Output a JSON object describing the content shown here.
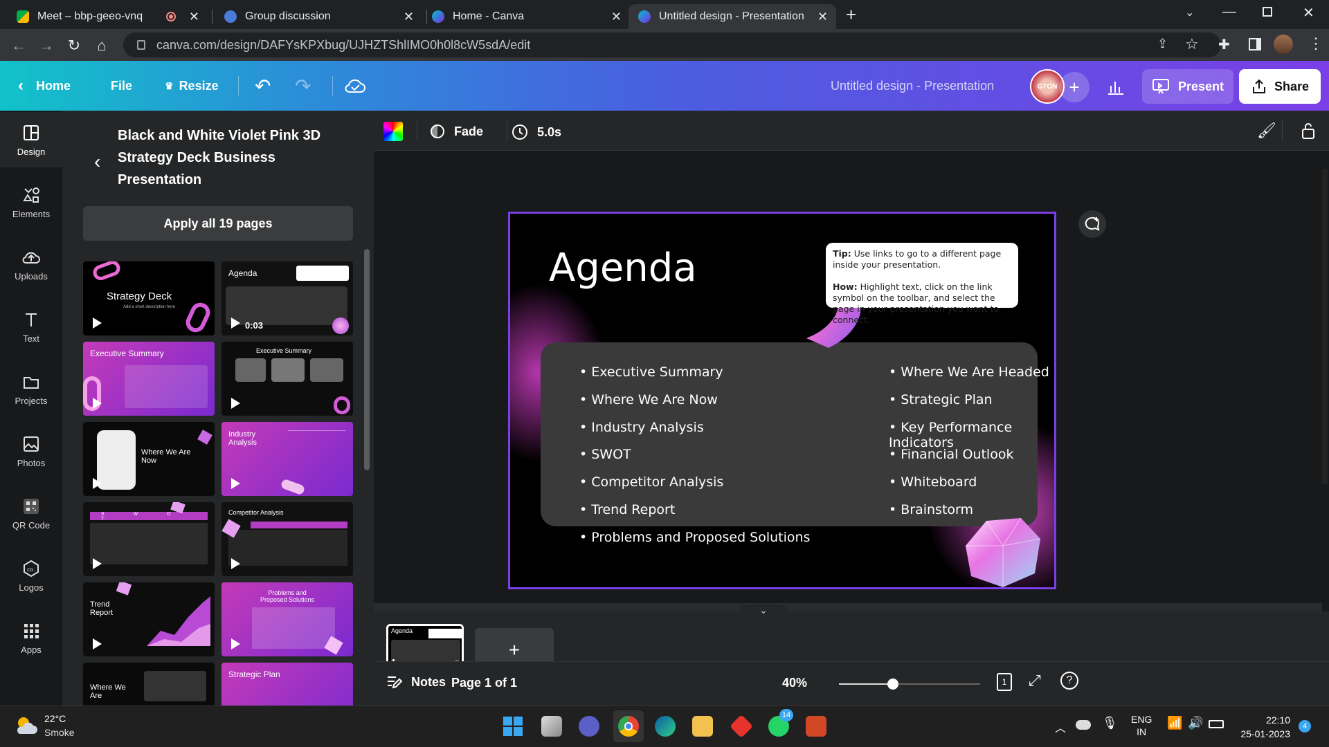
{
  "browser": {
    "tabs": [
      {
        "label": "Meet – bbp-geeo-vnq",
        "icon": "meet-icon",
        "active": false
      },
      {
        "label": "Group discussion",
        "icon": "group-icon",
        "active": false
      },
      {
        "label": "Home - Canva",
        "icon": "canva-icon",
        "active": false
      },
      {
        "label": "Untitled design - Presentation",
        "icon": "canva-icon",
        "active": true
      }
    ],
    "url": "canva.com/design/DAFYsKPXbug/UJHZTShlIMO0h0l8cW5sdA/edit"
  },
  "header": {
    "home_label": "Home",
    "file_label": "File",
    "resize_label": "Resize",
    "doc_title": "Untitled design - Presentation",
    "avatar_text": "GTON",
    "present_label": "Present",
    "share_label": "Share"
  },
  "sidebar": {
    "items": [
      {
        "label": "Design",
        "icon": "design-icon"
      },
      {
        "label": "Elements",
        "icon": "elements-icon"
      },
      {
        "label": "Uploads",
        "icon": "upload-icon"
      },
      {
        "label": "Text",
        "icon": "text-icon"
      },
      {
        "label": "Projects",
        "icon": "folder-icon"
      },
      {
        "label": "Photos",
        "icon": "photo-icon"
      },
      {
        "label": "QR Code",
        "icon": "qr-icon"
      },
      {
        "label": "Logos",
        "icon": "logo-icon"
      },
      {
        "label": "Apps",
        "icon": "apps-icon"
      }
    ]
  },
  "panel": {
    "title": "Black and White Violet Pink 3D Strategy Deck Business Presentation",
    "apply_label": "Apply all 19 pages",
    "thumbs": [
      {
        "label": "Strategy Deck",
        "sub": "Add a short description here"
      },
      {
        "label": "Agenda",
        "time": "0:03"
      },
      {
        "label": "Executive Summary"
      },
      {
        "label": "Executive Summary"
      },
      {
        "label": "Where We Are Now"
      },
      {
        "label": "Industry Analysis"
      },
      {
        "label": "S W O T"
      },
      {
        "label": "Competitor Analysis"
      },
      {
        "label": "Trend Report"
      },
      {
        "label": "Problems and Proposed Solutions"
      },
      {
        "label": "Where We Are"
      },
      {
        "label": "Strategic Plan"
      }
    ]
  },
  "toolbar": {
    "transition": "Fade",
    "duration": "5.0s"
  },
  "slide": {
    "title": "Agenda",
    "tip_label": "Tip:",
    "tip_text": "Use links to go to a different page inside your presentation.",
    "how_label": "How:",
    "how_text": "Highlight text, click on the link symbol on the toolbar, and select the page in your presentation  you want to connect.",
    "left_items": [
      "Executive Summary",
      "Where We Are Now",
      "Industry Analysis",
      "SWOT",
      "Competitor Analysis",
      "Trend Report",
      "Problems and Proposed Solutions"
    ],
    "right_items": [
      "Where We Are Headed",
      "Strategic Plan",
      "Key Performance Indicators",
      "Financial Outlook",
      "Whiteboard",
      "Brainstorm"
    ]
  },
  "pages": {
    "page_number": "1",
    "thumb_title": "Agenda"
  },
  "status": {
    "notes_label": "Notes",
    "page_label": "Page 1 of 1",
    "zoom": "40%",
    "zoom_fraction": 0.38,
    "page_count_badge": "1"
  },
  "taskbar": {
    "weather_temp": "22°C",
    "weather_desc": "Smoke",
    "lang_top": "ENG",
    "lang_bottom": "IN",
    "time": "22:10",
    "date": "25-01-2023",
    "whatsapp_badge": "14",
    "notif_badge": "4"
  }
}
